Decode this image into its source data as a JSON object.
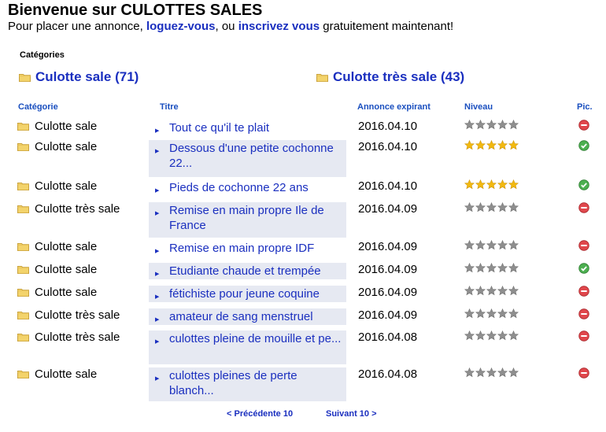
{
  "header": {
    "title": "Bienvenue sur CULOTTES SALES",
    "intro_prefix": "Pour placer une annonce,",
    "login_link": "loguez-vous",
    "intro_middle": ", ou",
    "register_link": "inscrivez vous",
    "intro_suffix": "gratuitement maintenant!"
  },
  "categories": {
    "label": "Catégories",
    "items": [
      {
        "label": "Culotte sale (71)",
        "icon": "folder-icon"
      },
      {
        "label": "Culotte très sale (43)",
        "icon": "folder-icon"
      }
    ]
  },
  "table": {
    "headers": [
      "Catégorie",
      "Titre",
      "Annonce expirant",
      "Niveau",
      "Pic."
    ],
    "rows": [
      {
        "category": "Culotte sale",
        "title": "Tout ce qu'il te plait",
        "date": "2016.04.10",
        "stars": "gray",
        "pic": "no"
      },
      {
        "category": "Culotte sale",
        "title": "Dessous d'une petite cochonne 22...",
        "date": "2016.04.10",
        "stars": "gold",
        "pic": "yes"
      },
      {
        "category": "Culotte sale",
        "title": "Pieds de cochonne 22 ans",
        "date": "2016.04.10",
        "stars": "gold",
        "pic": "yes"
      },
      {
        "category": "Culotte très sale",
        "title": "Remise en main propre Ile de France",
        "date": "2016.04.09",
        "stars": "gray",
        "pic": "no"
      },
      {
        "category": "Culotte sale",
        "title": "Remise en main propre IDF",
        "date": "2016.04.09",
        "stars": "gray",
        "pic": "no"
      },
      {
        "category": "Culotte sale",
        "title": "Etudiante chaude et trempée",
        "date": "2016.04.09",
        "stars": "gray",
        "pic": "yes"
      },
      {
        "category": "Culotte sale",
        "title": "fétichiste pour jeune coquine",
        "date": "2016.04.09",
        "stars": "gray",
        "pic": "no"
      },
      {
        "category": "Culotte très sale",
        "title": "amateur de sang menstruel",
        "date": "2016.04.09",
        "stars": "gray",
        "pic": "no"
      },
      {
        "category": "Culotte très sale",
        "title": "culottes pleine de mouille et pe...",
        "date": "2016.04.08",
        "stars": "gray",
        "pic": "no"
      },
      {
        "category": "Culotte sale",
        "title": "culottes pleines de perte blanch...",
        "date": "2016.04.08",
        "stars": "gray",
        "pic": "no"
      }
    ]
  },
  "pagination": {
    "prev_label": "< Précédente 10",
    "next_label": "Suivant 10 >"
  },
  "colors": {
    "link": "#1a2fbf",
    "header_text": "#1a4fbf",
    "title_bg": "#e6e9f2",
    "star_gold": "#f2b90f",
    "star_gray": "#8e8e8e",
    "pic_yes": "#4caf50",
    "pic_no": "#e0474c",
    "folder": "#f3d36b"
  }
}
